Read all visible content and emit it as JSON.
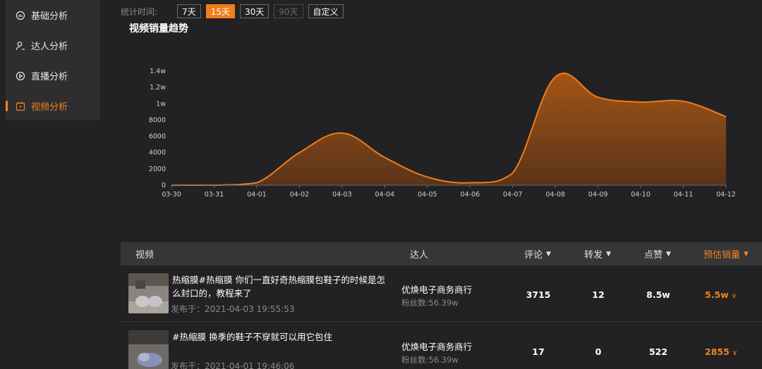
{
  "sidebar": {
    "items": [
      {
        "label": "基础分析",
        "icon": "analytics-icon",
        "active": false
      },
      {
        "label": "达人分析",
        "icon": "user-icon",
        "active": false
      },
      {
        "label": "直播分析",
        "icon": "play-circle-icon",
        "active": false
      },
      {
        "label": "视频分析",
        "icon": "video-icon",
        "active": true
      }
    ]
  },
  "time_filter": {
    "label": "统计时间:",
    "options": [
      {
        "label": "7天",
        "state": "normal"
      },
      {
        "label": "15天",
        "state": "active"
      },
      {
        "label": "30天",
        "state": "normal"
      },
      {
        "label": "90天",
        "state": "disabled"
      },
      {
        "label": "自定义",
        "state": "normal"
      }
    ]
  },
  "chart_title": "视频销量趋势",
  "chart_data": {
    "type": "area",
    "x": [
      "03-30",
      "03-31",
      "04-01",
      "04-02",
      "04-03",
      "04-04",
      "04-05",
      "04-06",
      "04-07",
      "04-08",
      "04-09",
      "04-10",
      "04-11",
      "04-12"
    ],
    "values": [
      0,
      0,
      300,
      4000,
      6400,
      3400,
      1000,
      300,
      1500,
      13300,
      10800,
      10200,
      10300,
      8400
    ],
    "y_ticks": [
      "0",
      "2000",
      "4000",
      "6000",
      "8000",
      "1w",
      "1.2w",
      "1.4w"
    ],
    "ylim": [
      0,
      14000
    ],
    "grid": false,
    "colors": {
      "line": "#f27d1b",
      "fill_top": "#a35516",
      "fill_bottom": "#5a3418"
    }
  },
  "table": {
    "headers": {
      "video": "视频",
      "talent": "达人",
      "comments": "评论",
      "shares": "转发",
      "likes": "点赞",
      "sales": "预估销量"
    },
    "rows": [
      {
        "title": "热缩膜#热缩膜 你们一直好奇热缩膜包鞋子的时候是怎么封口的，教程来了",
        "date": "发布于：2021-04-03 19:55:53",
        "talent": "优焕电子商务商行",
        "fans": "粉丝数:56.39w",
        "comments": "3715",
        "shares": "12",
        "likes": "8.5w",
        "sales": "5.5w"
      },
      {
        "title": "#热缩膜 换季的鞋子不穿就可以用它包住",
        "date": "发布于：2021-04-01 19:46:06",
        "talent": "优焕电子商务商行",
        "fans": "粉丝数:56.39w",
        "comments": "17",
        "shares": "0",
        "likes": "522",
        "sales": "2855"
      }
    ]
  }
}
